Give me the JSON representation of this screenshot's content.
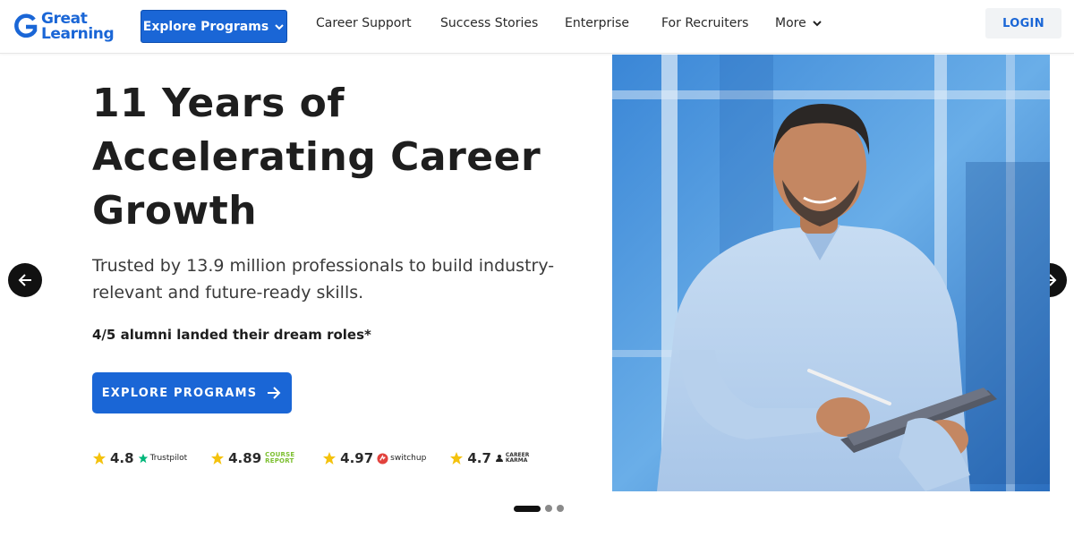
{
  "header": {
    "logo_line1": "Great",
    "logo_line2": "Learning",
    "explore_button": "Explore Programs",
    "nav": [
      "Career Support",
      "Success Stories",
      "Enterprise",
      "For Recruiters",
      "More"
    ],
    "login": "LOGIN",
    "brand_color": "#1a66d6"
  },
  "hero": {
    "title_lines": [
      "11 Years of",
      "Accelerating Career",
      "Growth"
    ],
    "subtitle_line1": "Trusted by 13.9 million professionals to build industry-",
    "subtitle_line2": "relevant and future-ready skills.",
    "note": "4/5 alumni landed their dream roles*",
    "cta": "EXPLORE PROGRAMS",
    "ratings": [
      {
        "value": "4.8",
        "brand": "Trustpilot",
        "icon": "trustpilot-star-icon"
      },
      {
        "value": "4.89",
        "brand": "COURSE REPORT",
        "icon": "course-report-logo"
      },
      {
        "value": "4.97",
        "brand": "switchup",
        "icon": "switchup-logo"
      },
      {
        "value": "4.7",
        "brand": "CAREER KARMA",
        "icon": "career-karma-logo"
      }
    ]
  },
  "carousel": {
    "prev_icon": "arrow-left-icon",
    "next_icon": "arrow-right-icon",
    "slides": 3,
    "active_slide": 1
  }
}
